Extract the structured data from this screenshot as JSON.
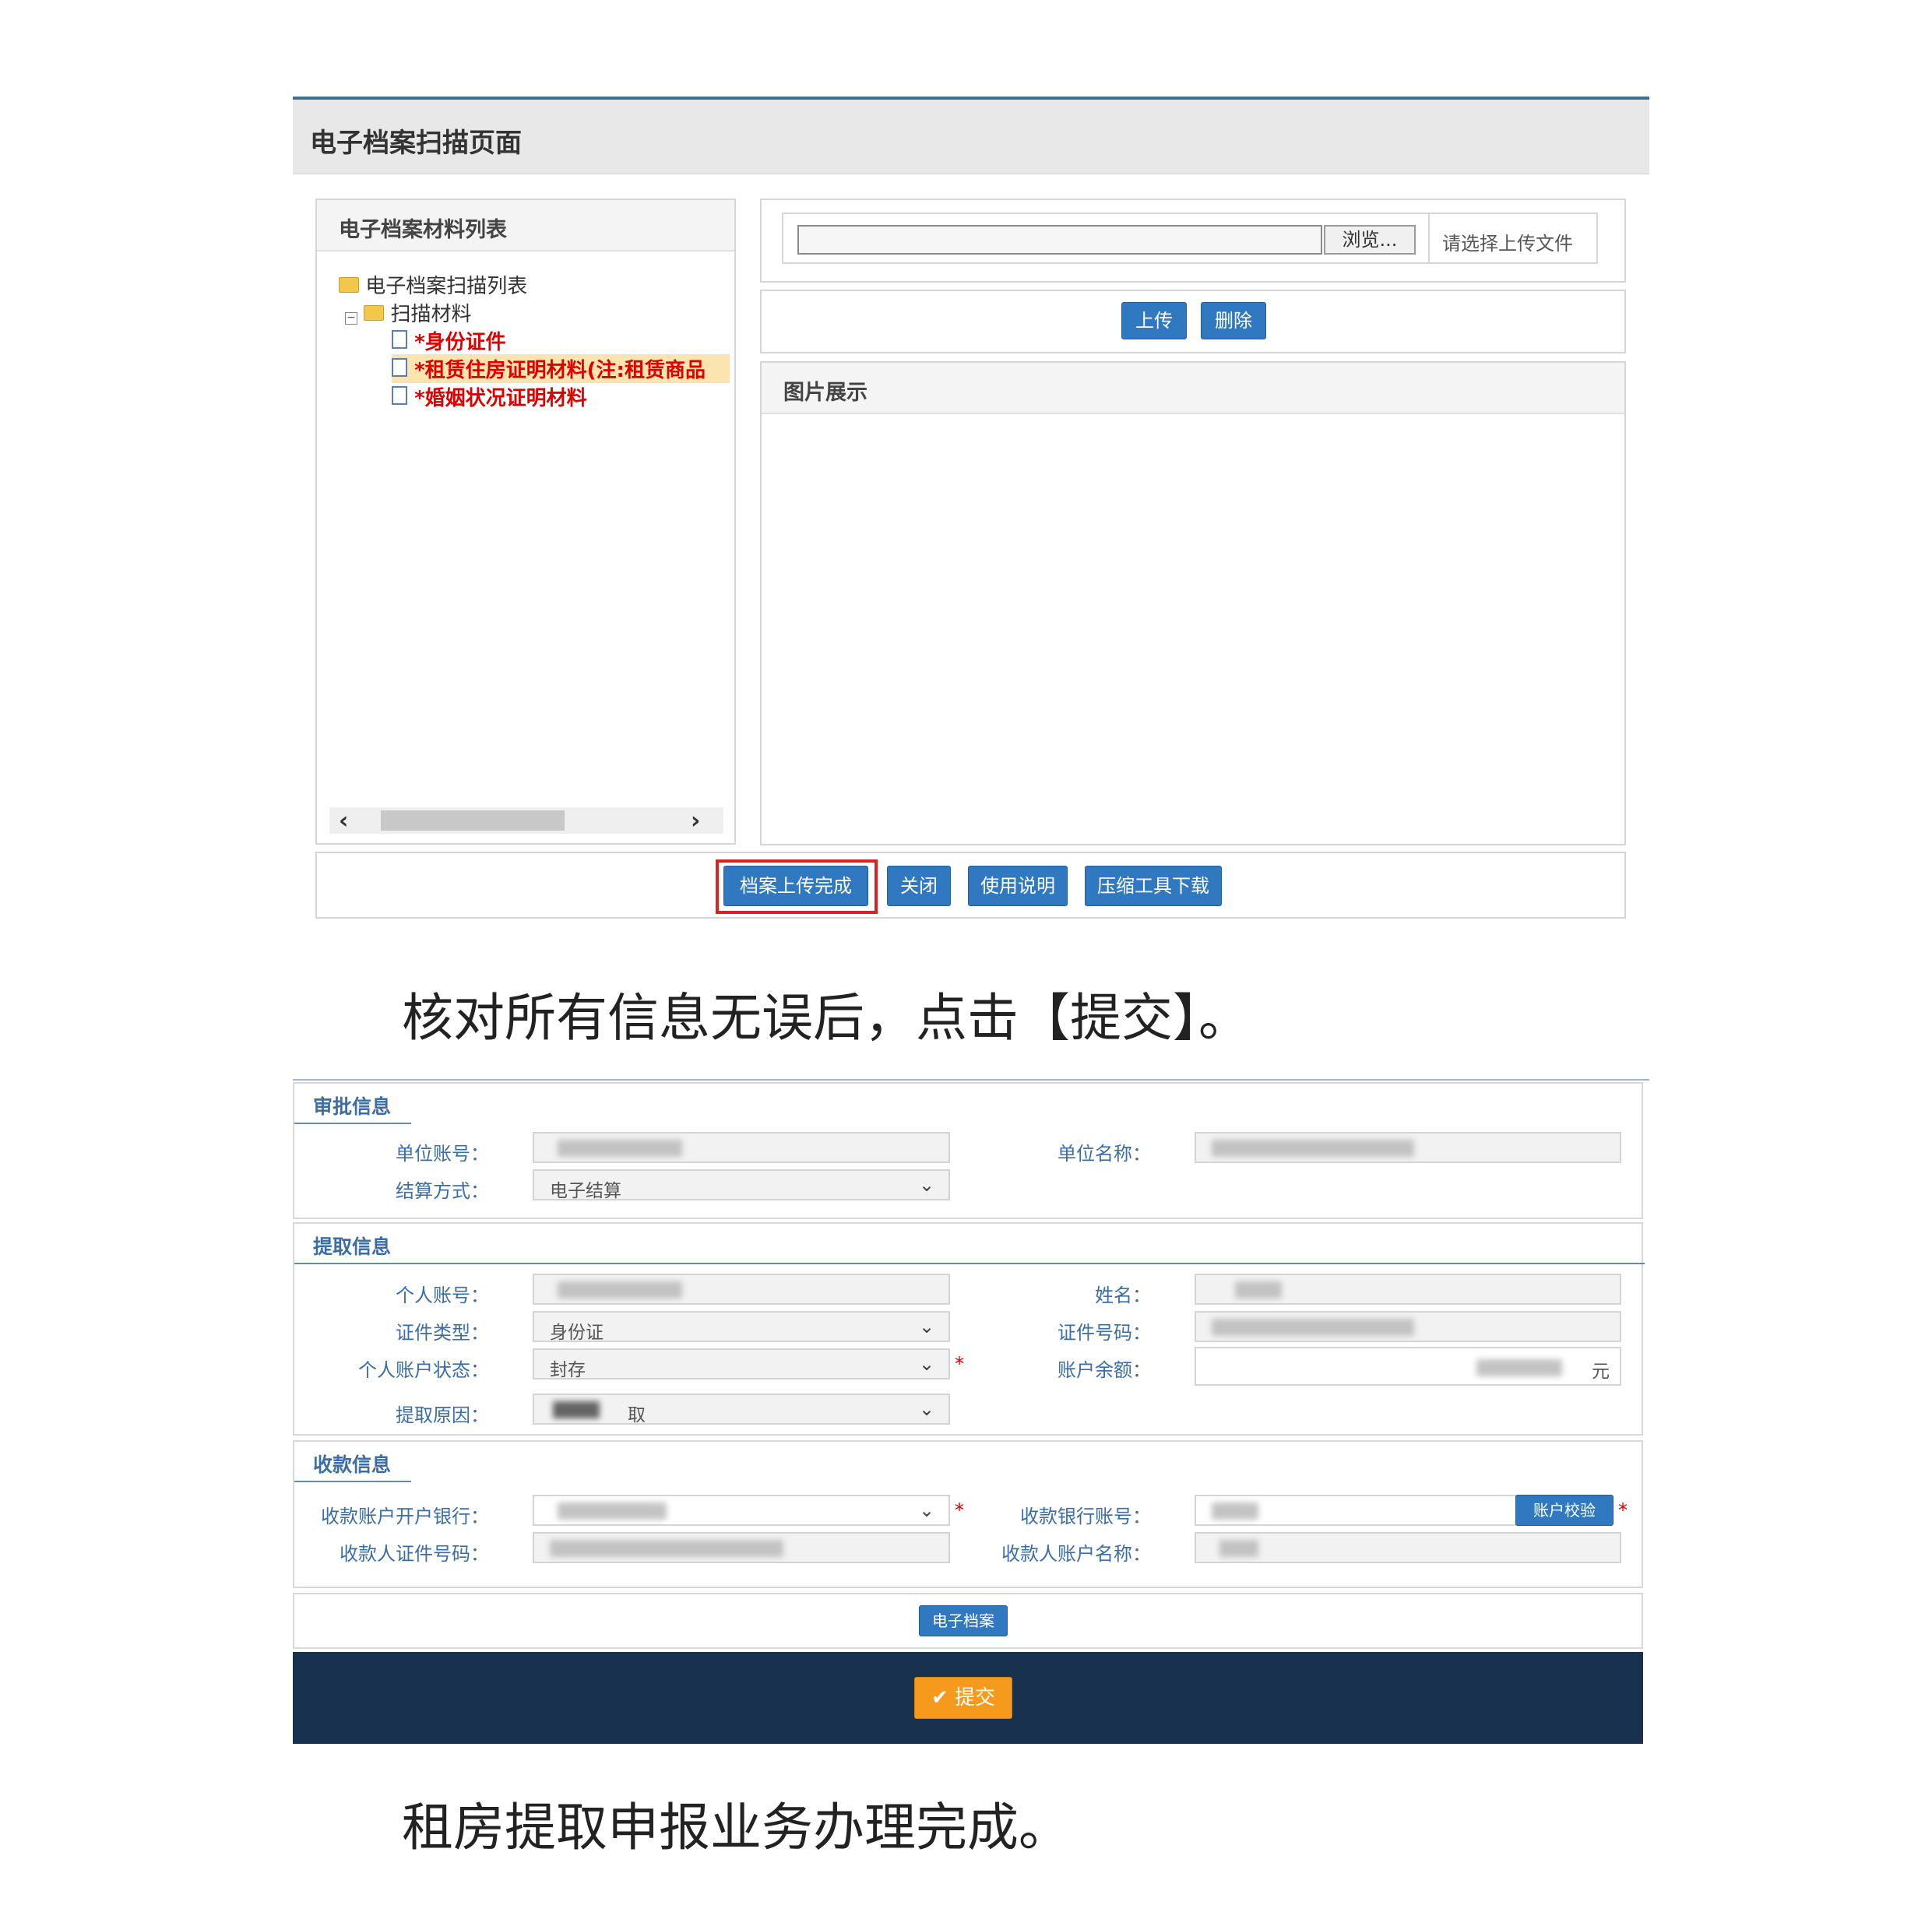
{
  "scan_page": {
    "title": "电子档案扫描页面",
    "materials_panel_title": "电子档案材料列表",
    "tree_root": "电子档案扫描列表",
    "tree_group": "扫描材料",
    "tree_items": [
      "*身份证件",
      "*租赁住房证明材料(注:租赁商品",
      "*婚姻状况证明材料"
    ],
    "browse_label": "浏览...",
    "file_hint": "请选择上传文件",
    "upload_label": "上传",
    "delete_label": "删除",
    "image_panel_title": "图片展示",
    "footer_buttons": [
      "档案上传完成",
      "关闭",
      "使用说明",
      "压缩工具下载"
    ]
  },
  "instruction_1": "核对所有信息无误后，点击【提交】。",
  "form": {
    "approval": {
      "title": "审批信息",
      "unit_account_label": "单位账号：",
      "unit_name_label": "单位名称：",
      "settlement_label": "结算方式：",
      "settlement_value": "电子结算"
    },
    "withdraw": {
      "title": "提取信息",
      "personal_account_label": "个人账号：",
      "name_label": "姓名：",
      "id_type_label": "证件类型：",
      "id_type_value": "身份证",
      "id_number_label": "证件号码：",
      "account_status_label": "个人账户状态：",
      "account_status_value": "封存",
      "balance_label": "账户余额：",
      "balance_unit": "元",
      "reason_label": "提取原因：",
      "reason_value": "取"
    },
    "payee": {
      "title": "收款信息",
      "bank_label": "收款账户开户银行：",
      "bank_account_label": "收款银行账号：",
      "verify_button": "账户校验",
      "payee_id_label": "收款人证件号码：",
      "payee_name_label": "收款人账户名称："
    },
    "e_archive_button": "电子档案",
    "submit_button": "✔ 提交"
  },
  "instruction_2": "租房提取申报业务办理完成。"
}
